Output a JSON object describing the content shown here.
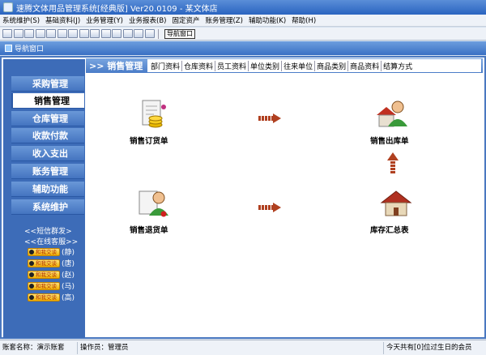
{
  "window": {
    "title": "速腾文体用品管理系统[经典版] Ver20.0109 - 某文体店"
  },
  "menu": [
    "系统维护(S)",
    "基础资料(J)",
    "业务管理(Y)",
    "业务报表(B)",
    "固定资产",
    "账务管理(Z)",
    "辅助功能(K)",
    "帮助(H)"
  ],
  "toolbar": {
    "nav_button": "导航窗口"
  },
  "nav_window": {
    "title": "导航窗口"
  },
  "sidebar": {
    "items": [
      "采购管理",
      "销售管理",
      "仓库管理",
      "收款付款",
      "收入支出",
      "账务管理",
      "辅助功能",
      "系统维护"
    ],
    "active_index": 1,
    "links": [
      "<<短信群发>",
      "<<在线客服>>"
    ],
    "qq": [
      {
        "badge": "和我交谈",
        "name": "(静)"
      },
      {
        "badge": "和我交谈",
        "name": "(唐)"
      },
      {
        "badge": "和我交谈",
        "name": "(赵)"
      },
      {
        "badge": "和我交谈",
        "name": "(马)"
      },
      {
        "badge": "和我交谈",
        "name": "(高)"
      }
    ]
  },
  "header": {
    "section_title": ">> 销售管理",
    "tabs": [
      "部门资料",
      "仓库资料",
      "员工资料",
      "单位类别",
      "往来单位",
      "商品类别",
      "商品资料",
      "结算方式"
    ]
  },
  "tiles": {
    "order": "销售订货单",
    "outbound": "销售出库单",
    "return": "销售退货单",
    "summary": "库存汇总表"
  },
  "colors": {
    "accent": "#3d6cb8",
    "arrow": "#b04020"
  },
  "status": {
    "account": "账套名称：演示账套",
    "operator": "操作员：管理员",
    "birthday": "今天共有[0]位过生日的会员"
  }
}
